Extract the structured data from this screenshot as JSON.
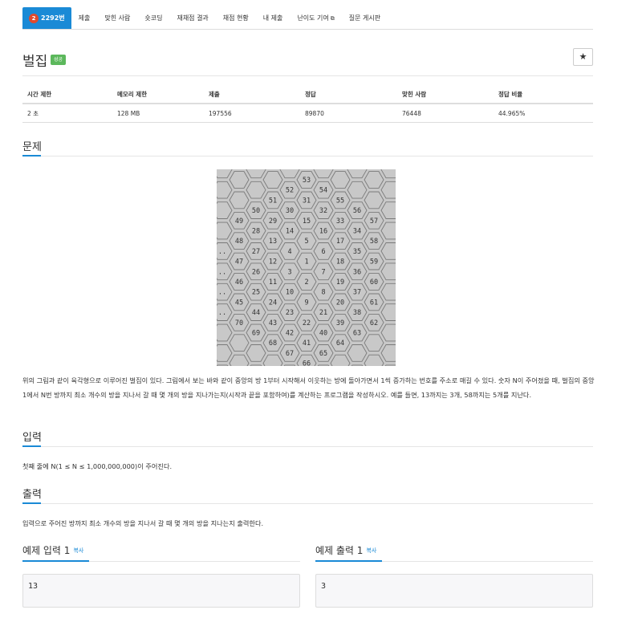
{
  "tabs": {
    "problem": {
      "tier": "2",
      "label": "2292번"
    },
    "items": [
      "제출",
      "맞힌 사람",
      "숏코딩",
      "재채점 결과",
      "채점 현황",
      "내 제출",
      "난이도 기여",
      "질문 게시판"
    ]
  },
  "problem": {
    "title": "벌집",
    "badge": "성공",
    "star": "★"
  },
  "stats": {
    "headers": [
      "시간 제한",
      "메모리 제한",
      "제출",
      "정답",
      "맞힌 사람",
      "정답 비율"
    ],
    "values": [
      "2 초",
      "128 MB",
      "197556",
      "89870",
      "76448",
      "44.965%"
    ]
  },
  "sections": {
    "description": "문제",
    "input": "입력",
    "output": "출력"
  },
  "figure": {
    "numbers": [
      {
        "n": "53",
        "col": 0,
        "row": 0
      },
      {
        "n": "52",
        "col": -1,
        "row": 1
      },
      {
        "n": "54",
        "col": 1,
        "row": 1
      },
      {
        "n": "51",
        "col": -2,
        "row": 2
      },
      {
        "n": "31",
        "col": 0,
        "row": 2
      },
      {
        "n": "55",
        "col": 2,
        "row": 2
      },
      {
        "n": "50",
        "col": -3,
        "row": 3
      },
      {
        "n": "30",
        "col": -1,
        "row": 3
      },
      {
        "n": "32",
        "col": 1,
        "row": 3
      },
      {
        "n": "56",
        "col": 3,
        "row": 3
      },
      {
        "n": "49",
        "col": -4,
        "row": 4
      },
      {
        "n": "29",
        "col": -2,
        "row": 4
      },
      {
        "n": "15",
        "col": 0,
        "row": 4
      },
      {
        "n": "33",
        "col": 2,
        "row": 4
      },
      {
        "n": "57",
        "col": 4,
        "row": 4
      },
      {
        "n": "28",
        "col": -3,
        "row": 5
      },
      {
        "n": "14",
        "col": -1,
        "row": 5
      },
      {
        "n": "16",
        "col": 1,
        "row": 5
      },
      {
        "n": "34",
        "col": 3,
        "row": 5
      },
      {
        "n": "48",
        "col": -4,
        "row": 6
      },
      {
        "n": "13",
        "col": -2,
        "row": 6
      },
      {
        "n": "5",
        "col": 0,
        "row": 6
      },
      {
        "n": "17",
        "col": 2,
        "row": 6
      },
      {
        "n": "58",
        "col": 4,
        "row": 6
      },
      {
        "n": "27",
        "col": -3,
        "row": 7
      },
      {
        "n": "4",
        "col": -1,
        "row": 7
      },
      {
        "n": "6",
        "col": 1,
        "row": 7
      },
      {
        "n": "35",
        "col": 3,
        "row": 7
      },
      {
        "n": "47",
        "col": -4,
        "row": 8
      },
      {
        "n": "12",
        "col": -2,
        "row": 8
      },
      {
        "n": "1",
        "col": 0,
        "row": 8
      },
      {
        "n": "18",
        "col": 2,
        "row": 8
      },
      {
        "n": "59",
        "col": 4,
        "row": 8
      },
      {
        "n": "26",
        "col": -3,
        "row": 9
      },
      {
        "n": "3",
        "col": -1,
        "row": 9
      },
      {
        "n": "7",
        "col": 1,
        "row": 9
      },
      {
        "n": "36",
        "col": 3,
        "row": 9
      },
      {
        "n": "46",
        "col": -4,
        "row": 10
      },
      {
        "n": "11",
        "col": -2,
        "row": 10
      },
      {
        "n": "2",
        "col": 0,
        "row": 10
      },
      {
        "n": "19",
        "col": 2,
        "row": 10
      },
      {
        "n": "60",
        "col": 4,
        "row": 10
      },
      {
        "n": "25",
        "col": -3,
        "row": 11
      },
      {
        "n": "10",
        "col": -1,
        "row": 11
      },
      {
        "n": "8",
        "col": 1,
        "row": 11
      },
      {
        "n": "37",
        "col": 3,
        "row": 11
      },
      {
        "n": "45",
        "col": -4,
        "row": 12
      },
      {
        "n": "24",
        "col": -2,
        "row": 12
      },
      {
        "n": "9",
        "col": 0,
        "row": 12
      },
      {
        "n": "20",
        "col": 2,
        "row": 12
      },
      {
        "n": "61",
        "col": 4,
        "row": 12
      },
      {
        "n": "44",
        "col": -3,
        "row": 13
      },
      {
        "n": "23",
        "col": -1,
        "row": 13
      },
      {
        "n": "21",
        "col": 1,
        "row": 13
      },
      {
        "n": "38",
        "col": 3,
        "row": 13
      },
      {
        "n": "70",
        "col": -4,
        "row": 14
      },
      {
        "n": "43",
        "col": -2,
        "row": 14
      },
      {
        "n": "22",
        "col": 0,
        "row": 14
      },
      {
        "n": "39",
        "col": 2,
        "row": 14
      },
      {
        "n": "62",
        "col": 4,
        "row": 14
      },
      {
        "n": "69",
        "col": -3,
        "row": 15
      },
      {
        "n": "42",
        "col": -1,
        "row": 15
      },
      {
        "n": "40",
        "col": 1,
        "row": 15
      },
      {
        "n": "63",
        "col": 3,
        "row": 15
      },
      {
        "n": "68",
        "col": -2,
        "row": 16
      },
      {
        "n": "41",
        "col": 0,
        "row": 16
      },
      {
        "n": "64",
        "col": 2,
        "row": 16
      },
      {
        "n": "67",
        "col": -1,
        "row": 17
      },
      {
        "n": "65",
        "col": 1,
        "row": 17
      },
      {
        "n": "66",
        "col": 0,
        "row": 18
      },
      {
        "n": "..",
        "col": -5,
        "row": 7
      },
      {
        "n": "..",
        "col": -5,
        "row": 9
      },
      {
        "n": "..",
        "col": -5,
        "row": 11
      },
      {
        "n": "..",
        "col": -5,
        "row": 13
      }
    ]
  },
  "description_text": "위의 그림과 같이 육각형으로 이루어진 벌집이 있다. 그림에서 보는 바와 같이 중앙의 방 1부터 시작해서 이웃하는 방에 돌아가면서 1씩 증가하는 번호를 주소로 매길 수 있다. 숫자 N이 주어졌을 때, 벌집의 중앙 1에서 N번 방까지 최소 개수의 방을 지나서 갈 때 몇 개의 방을 지나가는지(시작과 끝을 포함하여)를 계산하는 프로그램을 작성하시오. 예를 들면, 13까지는 3개, 58까지는 5개를 지난다.",
  "input_text": "첫째 줄에 N(1 ≤ N ≤ 1,000,000,000)이 주어진다.",
  "output_text": "입력으로 주어진 방까지 최소 개수의 방을 지나서 갈 때 몇 개의 방을 지나는지 출력한다.",
  "samples": {
    "input_title": "예제 입력 1",
    "output_title": "예제 출력 1",
    "copy_label": "복사",
    "input_value": "13",
    "output_value": "3"
  }
}
